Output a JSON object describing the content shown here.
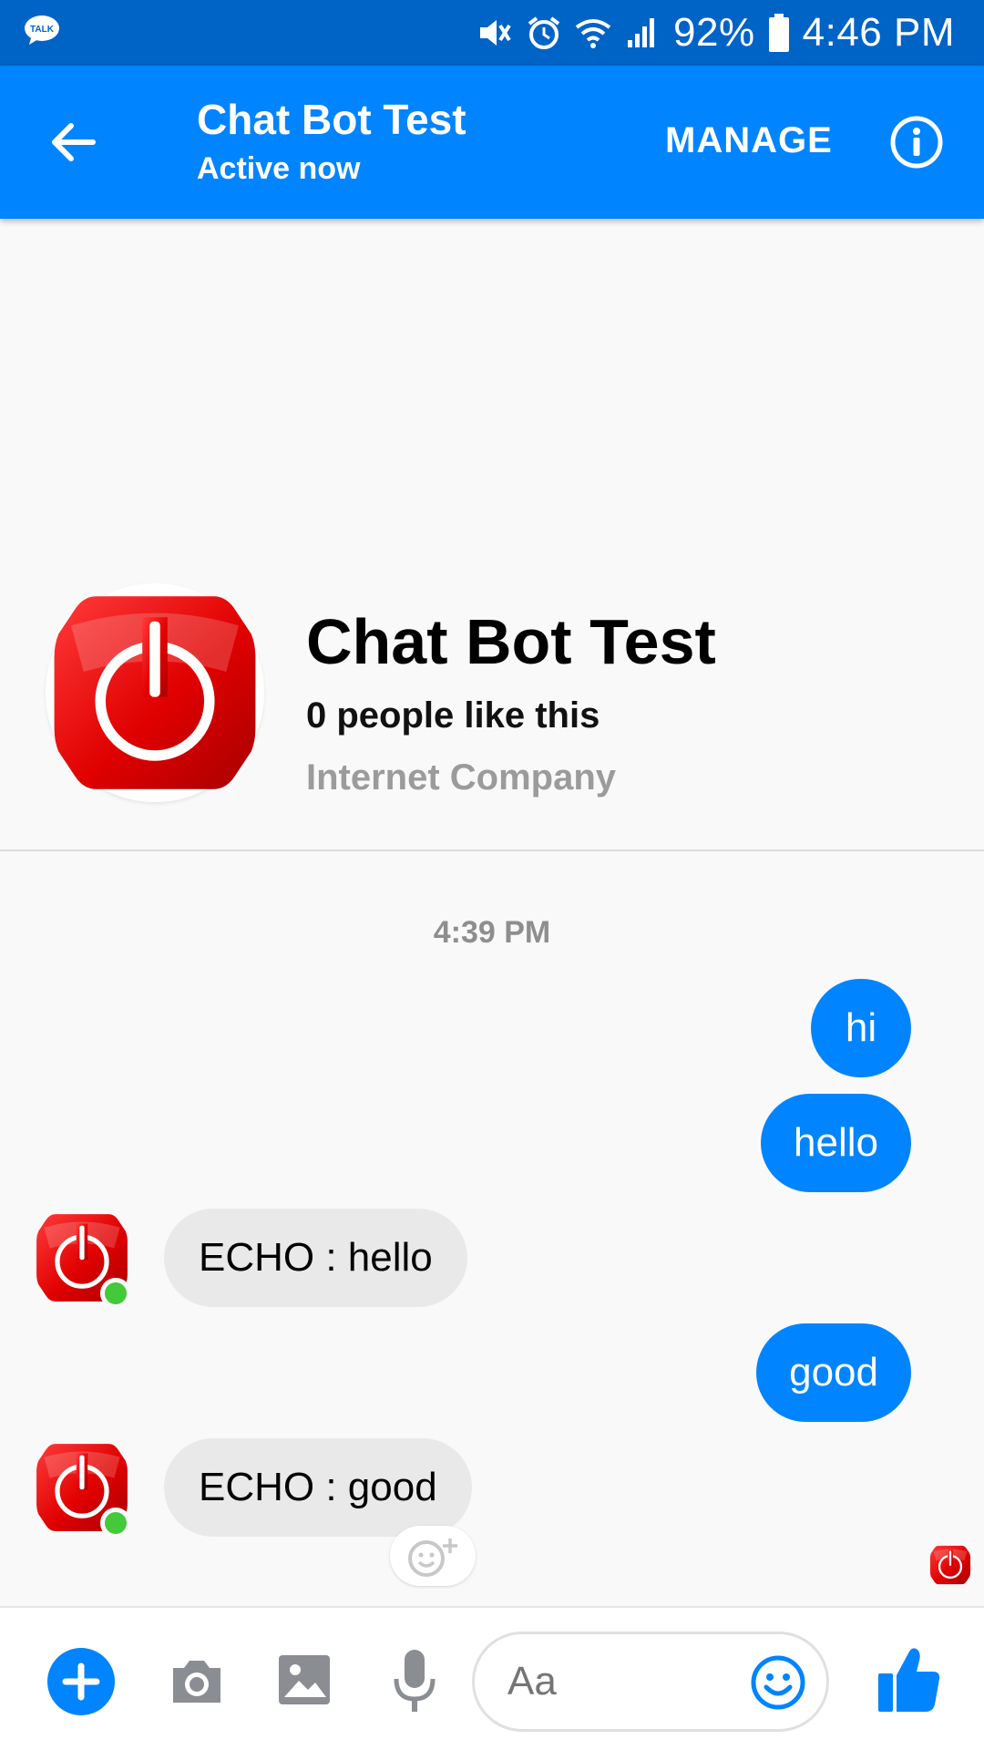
{
  "status_bar": {
    "battery": "92%",
    "time": "4:46 PM",
    "notification_icon_label": "TALK"
  },
  "header": {
    "title": "Chat Bot Test",
    "subtitle": "Active now",
    "manage_label": "MANAGE"
  },
  "profile": {
    "name": "Chat Bot Test",
    "likes": "0 people like this",
    "category": "Internet Company"
  },
  "conversation": {
    "timestamp": "4:39 PM",
    "messages": [
      {
        "from": "me",
        "text": "hi"
      },
      {
        "from": "me",
        "text": "hello"
      },
      {
        "from": "bot",
        "text": "ECHO : hello"
      },
      {
        "from": "me",
        "text": "good"
      },
      {
        "from": "bot",
        "text": "ECHO : good"
      }
    ]
  },
  "composer": {
    "placeholder": "Aa"
  },
  "colors": {
    "status_bar": "#0063c6",
    "app_bar": "#0084ff",
    "outgoing_bubble": "#0084ff",
    "incoming_bubble": "#e9e9e9",
    "online_dot": "#44c93a",
    "power_button_red": "#e00000"
  }
}
